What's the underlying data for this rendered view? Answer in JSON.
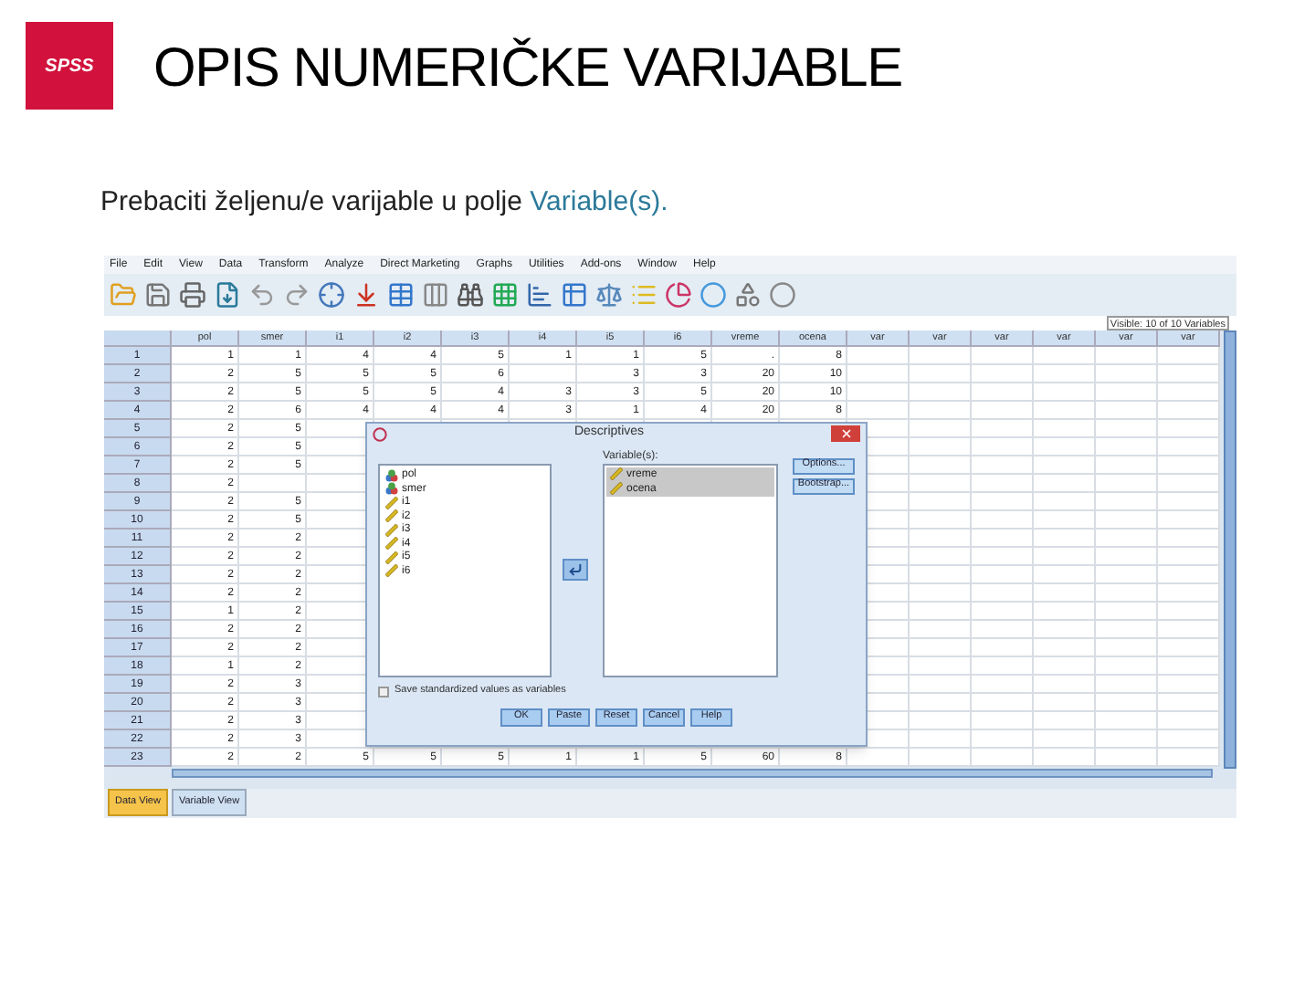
{
  "slide": {
    "logo": "SPSS",
    "title": "OPIS NUMERIČKE VARIJABLE",
    "instruction": "Prebaciti željenu/e varijable u polje",
    "highlight": "Variable(s)."
  },
  "spss": {
    "menu": [
      "File",
      "Edit",
      "View",
      "Data",
      "Transform",
      "Analyze",
      "Direct Marketing",
      "Graphs",
      "Utilities",
      "Add-ons",
      "Window",
      "Help"
    ],
    "name_box": "Visible: 10 of 10 Variables",
    "columns": [
      "pol",
      "smer",
      "i1",
      "i2",
      "i3",
      "i4",
      "i5",
      "i6",
      "vreme",
      "ocena",
      "var",
      "var",
      "var",
      "var",
      "var",
      "var"
    ],
    "rows": [
      {
        "num": "1",
        "cells": [
          "1",
          "1",
          "4",
          "4",
          "5",
          "1",
          "1",
          "5",
          ".",
          "8"
        ]
      },
      {
        "num": "2",
        "cells": [
          "2",
          "5",
          "5",
          "5",
          "6",
          "",
          "3",
          "3",
          "20",
          "10"
        ]
      },
      {
        "num": "3",
        "cells": [
          "2",
          "5",
          "5",
          "5",
          "4",
          "3",
          "3",
          "5",
          "20",
          "10"
        ]
      },
      {
        "num": "4",
        "cells": [
          "2",
          "6",
          "4",
          "4",
          "4",
          "3",
          "1",
          "4",
          "20",
          "8"
        ]
      },
      {
        "num": "5",
        "cells": [
          "2",
          "5"
        ]
      },
      {
        "num": "6",
        "cells": [
          "2",
          "5"
        ]
      },
      {
        "num": "7",
        "cells": [
          "2",
          "5"
        ]
      },
      {
        "num": "8",
        "cells": [
          "2",
          ""
        ]
      },
      {
        "num": "9",
        "cells": [
          "2",
          "5"
        ]
      },
      {
        "num": "10",
        "cells": [
          "2",
          "5"
        ]
      },
      {
        "num": "11",
        "cells": [
          "2",
          "2"
        ]
      },
      {
        "num": "12",
        "cells": [
          "2",
          "2"
        ]
      },
      {
        "num": "13",
        "cells": [
          "2",
          "2"
        ]
      },
      {
        "num": "14",
        "cells": [
          "2",
          "2"
        ]
      },
      {
        "num": "15",
        "cells": [
          "1",
          "2"
        ]
      },
      {
        "num": "16",
        "cells": [
          "2",
          "2"
        ]
      },
      {
        "num": "17",
        "cells": [
          "2",
          "2"
        ]
      },
      {
        "num": "18",
        "cells": [
          "1",
          "2"
        ]
      },
      {
        "num": "19",
        "cells": [
          "2",
          "3"
        ]
      },
      {
        "num": "20",
        "cells": [
          "2",
          "3"
        ]
      },
      {
        "num": "21",
        "cells": [
          "2",
          "3"
        ]
      },
      {
        "num": "22",
        "cells": [
          "2",
          "3"
        ]
      },
      {
        "num": "23",
        "cells": [
          "2",
          "2",
          "5",
          "5",
          "5",
          "1",
          "1",
          "5",
          "60",
          "8"
        ]
      }
    ],
    "tabs": [
      {
        "label": "Data View",
        "selected": true
      },
      {
        "label": "Variable View",
        "selected": false
      }
    ],
    "dialog": {
      "title": "Descriptives",
      "source_list": [
        {
          "name": "pol",
          "kind": "nominal"
        },
        {
          "name": "smer",
          "kind": "nominal"
        },
        {
          "name": "i1",
          "kind": "scale"
        },
        {
          "name": "i2",
          "kind": "scale"
        },
        {
          "name": "i3",
          "kind": "scale"
        },
        {
          "name": "i4",
          "kind": "scale"
        },
        {
          "name": "i5",
          "kind": "scale"
        },
        {
          "name": "i6",
          "kind": "scale"
        }
      ],
      "target_label": "Variable(s):",
      "target_list": [
        {
          "name": "vreme",
          "kind": "scale",
          "selected": true
        },
        {
          "name": "ocena",
          "kind": "scale",
          "selected": true
        }
      ],
      "side_buttons": [
        "Options...",
        "Bootstrap..."
      ],
      "checkbox": {
        "label": "Save standardized values as variables",
        "checked": false
      },
      "buttons": [
        "OK",
        "Paste",
        "Reset",
        "Cancel",
        "Help"
      ]
    }
  }
}
